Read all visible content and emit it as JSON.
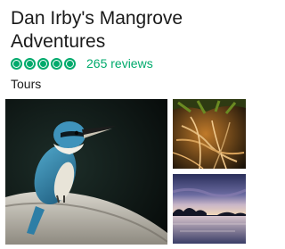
{
  "listing": {
    "title": "Dan Irby's Mangrove Adventures",
    "rating": 5,
    "rating_max": 5,
    "reviews_label": "265 reviews",
    "category": "Tours"
  },
  "colors": {
    "accent": "#00aa6c",
    "text": "#1a1a1a"
  },
  "photos": [
    {
      "subject": "kingfisher-on-branch"
    },
    {
      "subject": "mangrove-roots"
    },
    {
      "subject": "sunset-over-water"
    }
  ],
  "icons": {
    "rating": "rating-bubble-icon"
  }
}
